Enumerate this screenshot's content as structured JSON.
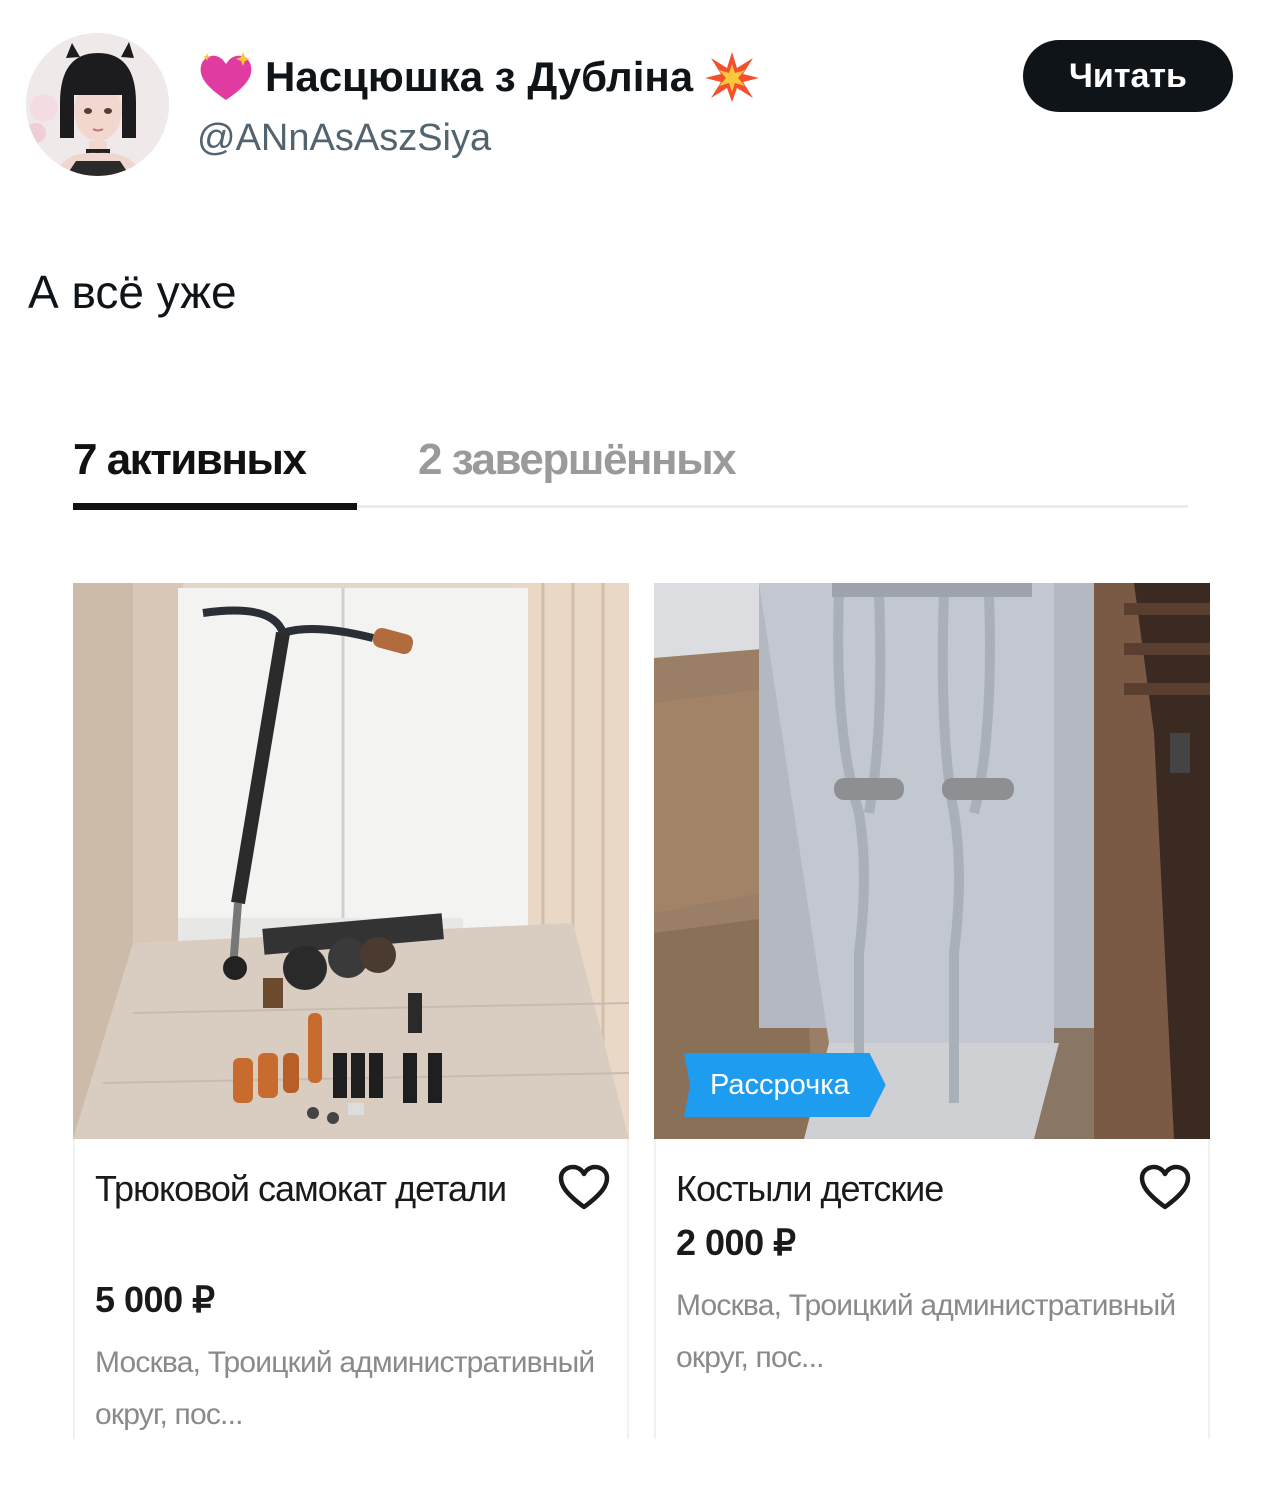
{
  "tweet": {
    "author_name": "Насцюшка з Дубліна",
    "author_handle": "@ANnAsAszSiya",
    "follow_label": "Читать",
    "text": "А всё уже"
  },
  "listing": {
    "tabs": [
      {
        "label": "7 активных"
      },
      {
        "label": "2 завершённых"
      }
    ],
    "cards": [
      {
        "title": "Трюковой самокат детали",
        "price": "5 000 ₽",
        "location": "Москва, Троицкий административный округ, пос..."
      },
      {
        "title": "Костыли детские",
        "price": "2 000 ₽",
        "location": "Москва, Троицкий административный округ, пос...",
        "badge": "Рассрочка"
      }
    ]
  }
}
